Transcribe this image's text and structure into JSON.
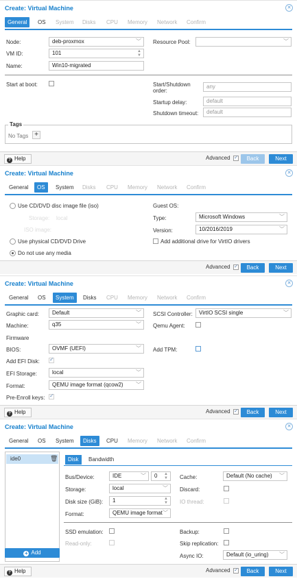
{
  "common": {
    "window_title": "Create: Virtual Machine",
    "help": "Help",
    "advanced": "Advanced",
    "back": "Back",
    "next": "Next",
    "tabs": [
      "General",
      "OS",
      "System",
      "Disks",
      "CPU",
      "Memory",
      "Network",
      "Confirm"
    ]
  },
  "general": {
    "node_label": "Node:",
    "node_value": "deb-proxmox",
    "resource_pool_label": "Resource Pool:",
    "resource_pool_value": "",
    "vmid_label": "VM ID:",
    "vmid_value": "101",
    "name_label": "Name:",
    "name_value": "Win10-migrated",
    "start_at_boot_label": "Start at boot:",
    "startup_order_label": "Start/Shutdown order:",
    "startup_order_placeholder": "any",
    "startup_delay_label": "Startup delay:",
    "startup_delay_placeholder": "default",
    "shutdown_timeout_label": "Shutdown timeout:",
    "shutdown_timeout_placeholder": "default",
    "tags_legend": "Tags",
    "no_tags": "No Tags"
  },
  "os": {
    "use_iso_label": "Use CD/DVD disc image file (iso)",
    "storage_label": "Storage:",
    "storage_value": "local",
    "iso_image_label": "ISO image:",
    "use_physical_label": "Use physical CD/DVD Drive",
    "no_media_label": "Do not use any media",
    "guest_os_label": "Guest OS:",
    "type_label": "Type:",
    "type_value": "Microsoft Windows",
    "version_label": "Version:",
    "version_value": "10/2016/2019",
    "virtio_drive_label": "Add additional drive for VirtIO drivers"
  },
  "system": {
    "graphic_card_label": "Graphic card:",
    "graphic_card_value": "Default",
    "machine_label": "Machine:",
    "machine_value": "q35",
    "firmware_heading": "Firmware",
    "bios_label": "BIOS:",
    "bios_value": "OVMF (UEFI)",
    "add_efi_label": "Add EFI Disk:",
    "efi_storage_label": "EFI Storage:",
    "efi_storage_value": "local",
    "format_label": "Format:",
    "format_value": "QEMU image format (qcow2)",
    "pre_enroll_label": "Pre-Enroll keys:",
    "scsi_label": "SCSI Controller:",
    "scsi_value": "VirtIO SCSI single",
    "qemu_agent_label": "Qemu Agent:",
    "add_tpm_label": "Add TPM:"
  },
  "disks": {
    "disk_item": "ide0",
    "add_label": "Add",
    "subtab_disk": "Disk",
    "subtab_bandwidth": "Bandwidth",
    "bus_label": "Bus/Device:",
    "bus_value": "IDE",
    "device_value": "0",
    "storage_label": "Storage:",
    "storage_value": "local",
    "size_label": "Disk size (GiB):",
    "size_value": "1",
    "format_label": "Format:",
    "format_value": "QEMU image format",
    "cache_label": "Cache:",
    "cache_value": "Default (No cache)",
    "discard_label": "Discard:",
    "io_thread_label": "IO thread:",
    "ssd_label": "SSD emulation:",
    "readonly_label": "Read-only:",
    "backup_label": "Backup:",
    "skip_replication_label": "Skip replication:",
    "async_io_label": "Async IO:",
    "async_io_value": "Default (io_uring)"
  }
}
